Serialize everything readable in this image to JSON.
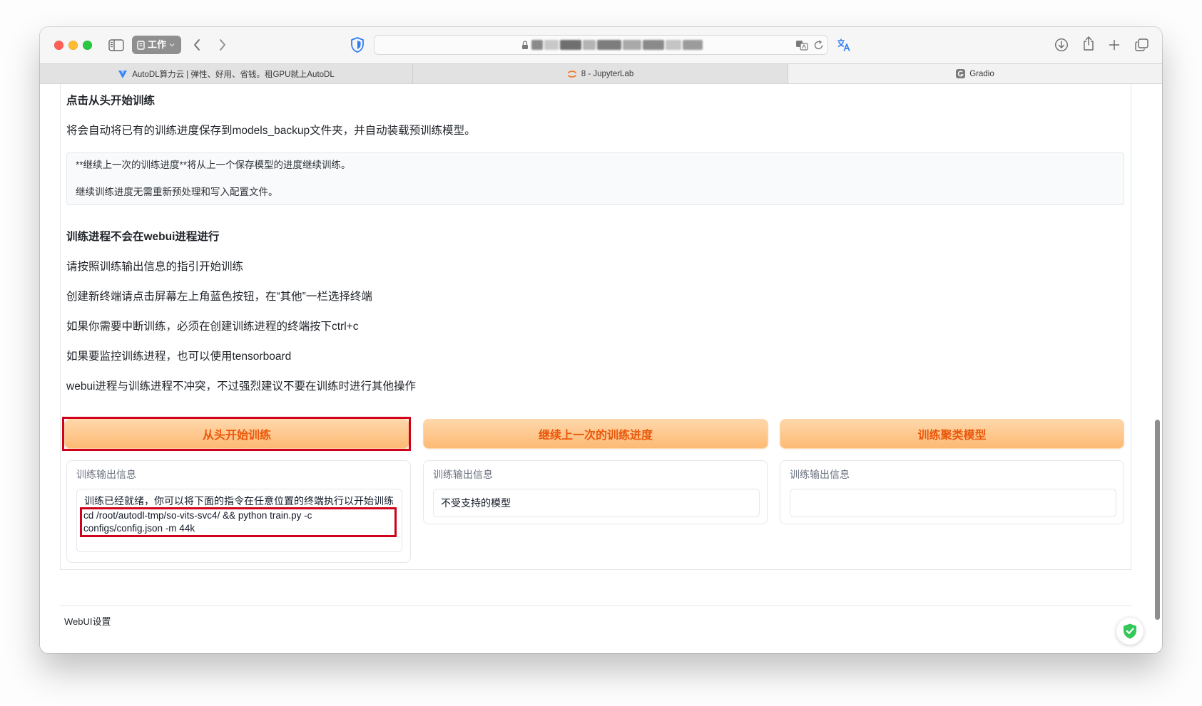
{
  "browser": {
    "tab_group": {
      "label": "工作",
      "icon": "tab-group-icon"
    },
    "toolbar_icons": {
      "sidebar": "sidebar-icon",
      "back": "back-icon",
      "forward": "forward-icon",
      "privacy": "privacy-shield-icon",
      "lock": "lock-icon",
      "translate_address": "translate-icon",
      "reload": "reload-icon",
      "translate_page": "translate-page-icon",
      "download": "download-icon",
      "share": "share-icon",
      "new_tab": "new-tab-icon",
      "tab_overview": "tab-overview-icon"
    },
    "tabs": [
      {
        "label": "AutoDL算力云 | 弹性、好用、省钱。租GPU就上AutoDL",
        "icon": "autodl-logo-icon",
        "active": false
      },
      {
        "label": "8 - JupyterLab",
        "icon": "jupyter-logo-icon",
        "active": false
      },
      {
        "label": "Gradio",
        "icon": "gradio-logo-icon",
        "active": true
      }
    ]
  },
  "content": {
    "heading_start": "点击从头开始训练",
    "start_description": "将会自动将已有的训练进度保存到models_backup文件夹，并自动装载预训练模型。",
    "resume_note": [
      "**继续上一次的训练进度**将从上一个保存模型的进度继续训练。",
      "继续训练进度无需重新预处理和写入配置文件。"
    ],
    "heading_process": "训练进程不会在webui进程进行",
    "instructions": [
      "请按照训练输出信息的指引开始训练",
      "创建新终端请点击屏幕左上角蓝色按钮，在“其他”一栏选择终端",
      "如果你需要中断训练，必须在创建训练进程的终端按下ctrl+c",
      "如果要监控训练进程，也可以使用tensorboard",
      "webui进程与训练进程不冲突，不过强烈建议不要在训练时进行其他操作"
    ]
  },
  "actions": [
    {
      "button_label": "从头开始训练",
      "output_label": "训练输出信息",
      "output_lines": [
        "训练已经就绪，你可以将下面的指令在任意位置的终端执行以开始训练",
        "cd /root/autodl-tmp/so-vits-svc4/ && python train.py -c configs/config.json -m 44k"
      ]
    },
    {
      "button_label": "继续上一次的训练进度",
      "output_label": "训练输出信息",
      "output_lines": [
        "不受支持的模型"
      ]
    },
    {
      "button_label": "训练聚类模型",
      "output_label": "训练输出信息",
      "output_lines": []
    }
  ],
  "footer": {
    "settings_label": "WebUI设置",
    "badge_icon": "shield-check-icon"
  },
  "colors": {
    "button_text": "#ea580c",
    "button_gradient_top": "#fed7aa",
    "button_gradient_bottom": "#fdba74",
    "annotation_red": "#d0021b",
    "privacy_icon_blue": "#2f7cf6",
    "badge_green": "#34c759"
  }
}
